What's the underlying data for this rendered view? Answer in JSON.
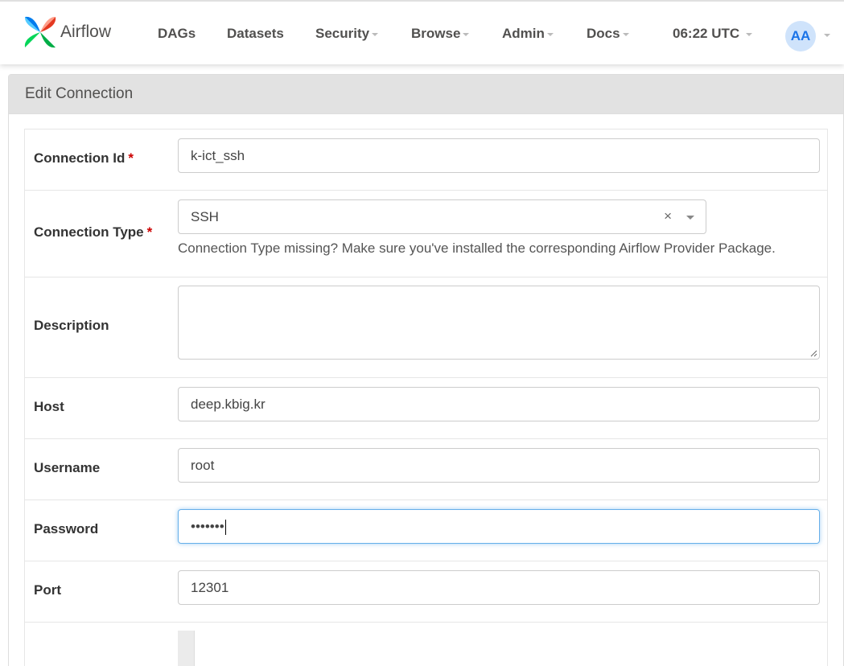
{
  "navbar": {
    "brand": "Airflow",
    "items": [
      {
        "label": "DAGs",
        "dropdown": false
      },
      {
        "label": "Datasets",
        "dropdown": false
      },
      {
        "label": "Security",
        "dropdown": true
      },
      {
        "label": "Browse",
        "dropdown": true
      },
      {
        "label": "Admin",
        "dropdown": true
      },
      {
        "label": "Docs",
        "dropdown": true
      }
    ],
    "clock": "06:22 UTC",
    "avatar_initials": "AA"
  },
  "panel": {
    "title": "Edit Connection"
  },
  "form": {
    "connection_id": {
      "label": "Connection Id",
      "required_mark": "*",
      "value": "k-ict_ssh"
    },
    "connection_type": {
      "label": "Connection Type",
      "required_mark": "*",
      "value": "SSH",
      "clear": "×",
      "help": "Connection Type missing? Make sure you've installed the corresponding Airflow Provider Package."
    },
    "description": {
      "label": "Description",
      "value": ""
    },
    "host": {
      "label": "Host",
      "value": "deep.kbig.kr"
    },
    "username": {
      "label": "Username",
      "value": "root"
    },
    "password": {
      "label": "Password",
      "value": "•••••••"
    },
    "port": {
      "label": "Port",
      "value": "12301"
    }
  },
  "colors": {
    "accent": "#66afe9",
    "required": "#cc0000",
    "avatar_bg": "#cfe3fb",
    "avatar_fg": "#1a73e8"
  }
}
